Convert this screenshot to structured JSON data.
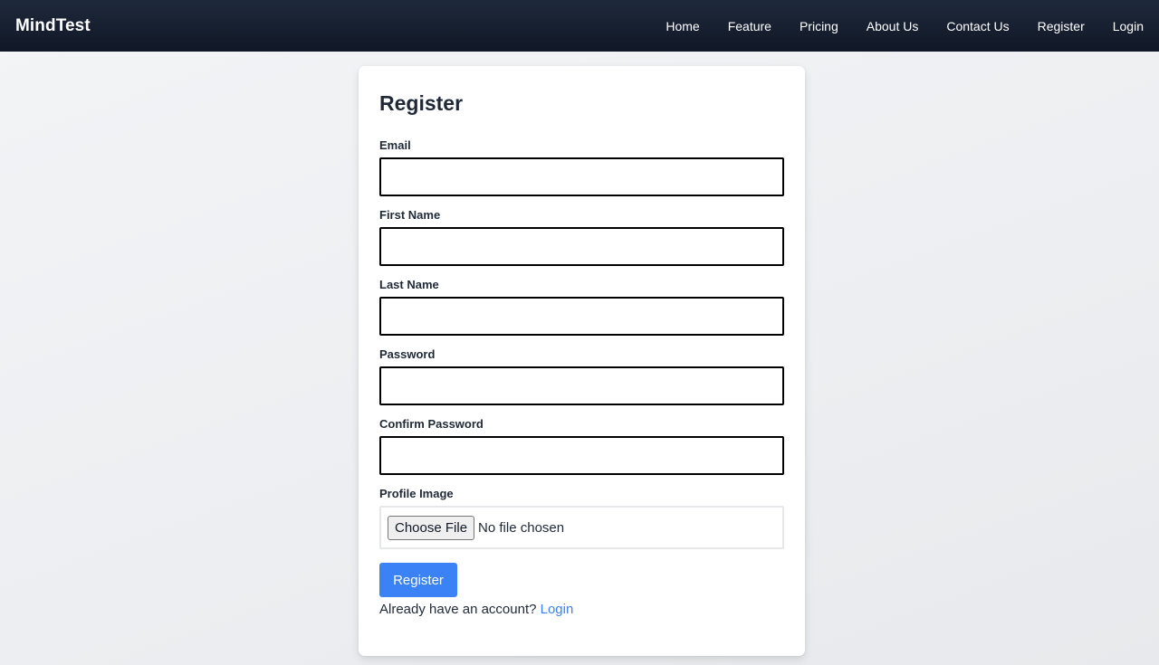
{
  "nav": {
    "brand": "MindTest",
    "links": [
      {
        "label": "Home"
      },
      {
        "label": "Feature"
      },
      {
        "label": "Pricing"
      },
      {
        "label": "About Us"
      },
      {
        "label": "Contact Us"
      },
      {
        "label": "Register"
      },
      {
        "label": "Login"
      }
    ]
  },
  "form": {
    "title": "Register",
    "fields": [
      {
        "label": "Email",
        "value": ""
      },
      {
        "label": "First Name",
        "value": ""
      },
      {
        "label": "Last Name",
        "value": ""
      },
      {
        "label": "Password",
        "value": ""
      },
      {
        "label": "Confirm Password",
        "value": ""
      }
    ],
    "profile_image": {
      "label": "Profile Image",
      "button_label": "Choose File",
      "status": "No file chosen"
    },
    "submit_label": "Register",
    "footer_text": "Already have an account?",
    "footer_link": "Login"
  },
  "colors": {
    "navbar": "#111827",
    "accent": "#3b82f6",
    "card": "#ffffff"
  }
}
